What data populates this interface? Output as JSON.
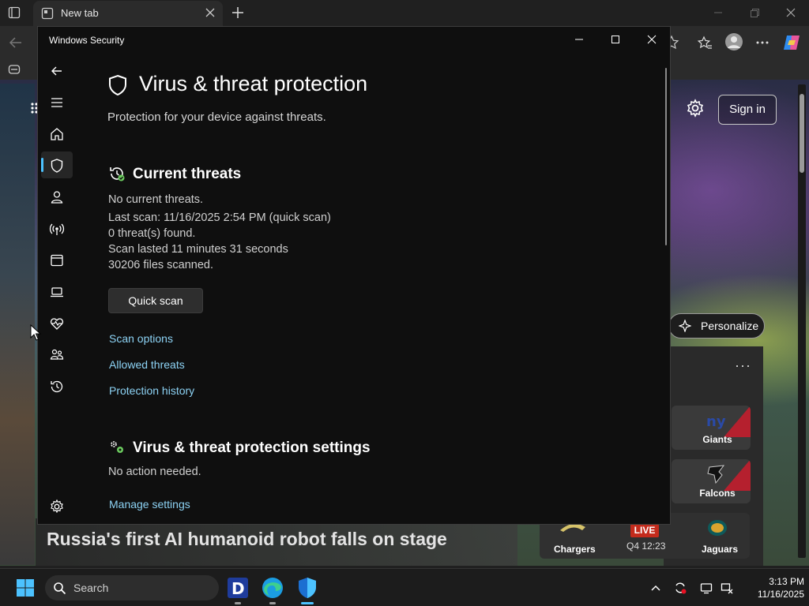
{
  "browser": {
    "tab_title": "New tab"
  },
  "newtab_page": {
    "sign_in": "Sign in",
    "personalize": "Personalize",
    "sports_more": "···",
    "teams": [
      "Giants",
      "Falcons",
      "Jaguars"
    ],
    "game": {
      "home": "Chargers",
      "status": "LIVE",
      "clock": "Q4 12:23"
    },
    "headline": "Russia's first AI humanoid robot falls on stage"
  },
  "security_window": {
    "title": "Windows Security",
    "page_title": "Virus & threat protection",
    "page_subtitle": "Protection for your device against threats.",
    "current_threats": {
      "heading": "Current threats",
      "lines": [
        "No current threats.",
        "Last scan: 11/16/2025 2:54 PM (quick scan)",
        "0 threat(s) found.",
        "Scan lasted 11 minutes 31 seconds",
        "30206 files scanned."
      ],
      "quick_scan": "Quick scan",
      "links": [
        "Scan options",
        "Allowed threats",
        "Protection history"
      ]
    },
    "settings_section": {
      "heading": "Virus & threat protection settings",
      "status": "No action needed.",
      "link": "Manage settings"
    }
  },
  "taskbar": {
    "search_placeholder": "Search",
    "time": "3:13 PM",
    "date": "11/16/2025"
  },
  "colors": {
    "accent": "#4cc2ff",
    "link": "#8dd3f5",
    "window_bg": "#0f0f0f",
    "live_red": "#c42b1c"
  }
}
